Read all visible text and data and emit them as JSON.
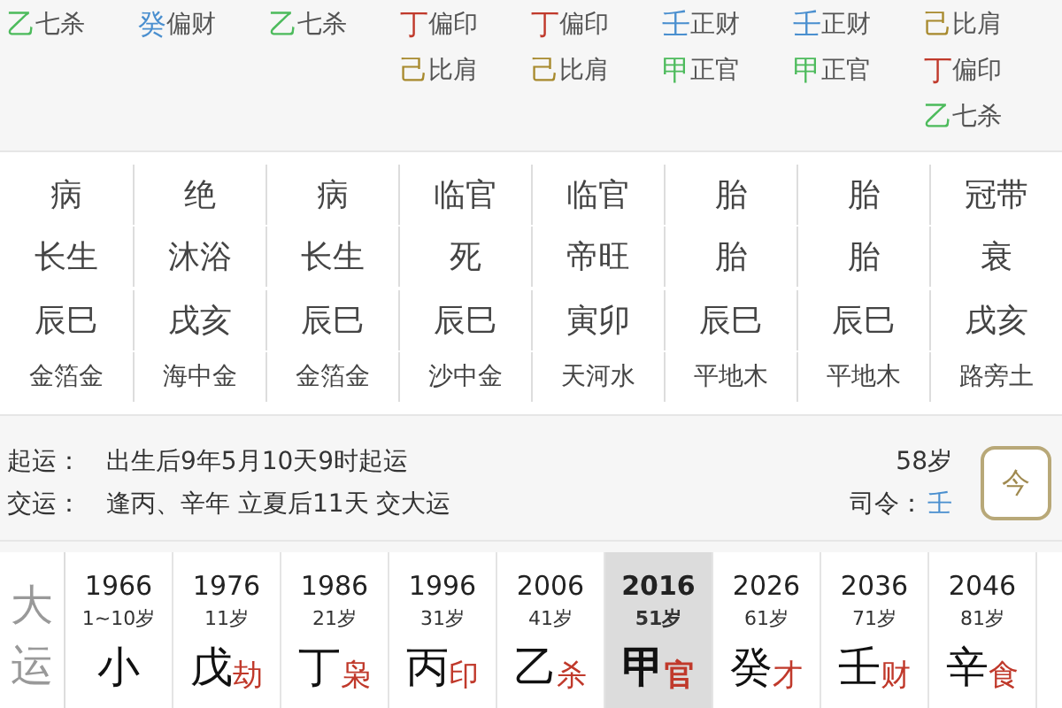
{
  "hidden_stems": [
    {
      "items": [
        {
          "stem": "乙",
          "god": "七杀",
          "color": "#4dbb5c"
        }
      ]
    },
    {
      "items": [
        {
          "stem": "癸",
          "god": "偏财",
          "color": "#4a8fcf"
        }
      ]
    },
    {
      "items": [
        {
          "stem": "乙",
          "god": "七杀",
          "color": "#4dbb5c"
        }
      ]
    },
    {
      "items": [
        {
          "stem": "丁",
          "god": "偏印",
          "color": "#c0392b"
        },
        {
          "stem": "己",
          "god": "比肩",
          "color": "#a88a2e"
        }
      ]
    },
    {
      "items": [
        {
          "stem": "丁",
          "god": "偏印",
          "color": "#c0392b"
        },
        {
          "stem": "己",
          "god": "比肩",
          "color": "#a88a2e"
        }
      ]
    },
    {
      "items": [
        {
          "stem": "壬",
          "god": "正财",
          "color": "#4a8fcf"
        },
        {
          "stem": "甲",
          "god": "正官",
          "color": "#4dbb5c"
        }
      ]
    },
    {
      "items": [
        {
          "stem": "壬",
          "god": "正财",
          "color": "#4a8fcf"
        },
        {
          "stem": "甲",
          "god": "正官",
          "color": "#4dbb5c"
        }
      ]
    },
    {
      "items": [
        {
          "stem": "己",
          "god": "比肩",
          "color": "#a88a2e"
        },
        {
          "stem": "丁",
          "god": "偏印",
          "color": "#c0392b"
        },
        {
          "stem": "乙",
          "god": "七杀",
          "color": "#4dbb5c"
        }
      ]
    }
  ],
  "pillar_rows": [
    {
      "kind": "main",
      "cells": [
        "病",
        "绝",
        "病",
        "临官",
        "临官",
        "胎",
        "胎",
        "冠带"
      ]
    },
    {
      "kind": "main",
      "cells": [
        "长生",
        "沐浴",
        "长生",
        "死",
        "帝旺",
        "胎",
        "胎",
        "衰"
      ]
    },
    {
      "kind": "main",
      "cells": [
        "辰巳",
        "戌亥",
        "辰巳",
        "辰巳",
        "寅卯",
        "辰巳",
        "辰巳",
        "戌亥"
      ]
    },
    {
      "kind": "small",
      "cells": [
        "金箔金",
        "海中金",
        "金箔金",
        "沙中金",
        "天河水",
        "平地木",
        "平地木",
        "路旁土"
      ]
    }
  ],
  "info": {
    "qiyun_label": "起运：",
    "qiyun_text": "出生后9年5月10天9时起运",
    "age": "58岁",
    "jiaoyun_label": "交运：",
    "jiaoyun_text": "逢丙、辛年 立夏后11天 交大运",
    "siling_label": "司令：",
    "siling_value": "壬",
    "today_button": "今"
  },
  "dayun": {
    "label": "大运",
    "columns": [
      {
        "year": "1966",
        "age": "1~10岁",
        "stem": "小",
        "selected": false
      },
      {
        "year": "1976",
        "age": "11岁",
        "stem": "戊",
        "god": "劫",
        "selected": false
      },
      {
        "year": "1986",
        "age": "21岁",
        "stem": "丁",
        "god": "枭",
        "selected": false
      },
      {
        "year": "1996",
        "age": "31岁",
        "stem": "丙",
        "god": "印",
        "selected": false
      },
      {
        "year": "2006",
        "age": "41岁",
        "stem": "乙",
        "god": "杀",
        "selected": false
      },
      {
        "year": "2016",
        "age": "51岁",
        "stem": "甲",
        "god": "官",
        "selected": true
      },
      {
        "year": "2026",
        "age": "61岁",
        "stem": "癸",
        "god": "才",
        "selected": false
      },
      {
        "year": "2036",
        "age": "71岁",
        "stem": "壬",
        "god": "财",
        "selected": false
      },
      {
        "year": "2046",
        "age": "81岁",
        "stem": "辛",
        "god": "食",
        "selected": false
      }
    ]
  }
}
